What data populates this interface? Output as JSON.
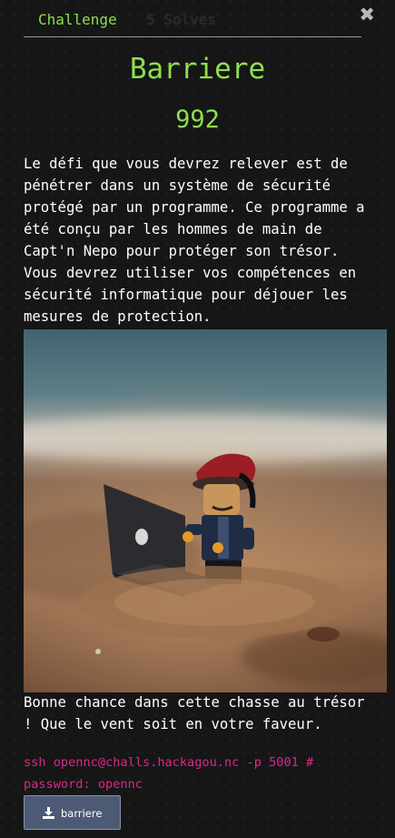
{
  "tabs": {
    "challenge_label": "Challenge",
    "solves_label": "5 Solves"
  },
  "close_icon": "close-icon",
  "challenge": {
    "name": "Barriere",
    "points": "992",
    "description": "Le défi que vous devrez relever est de\npénétrer dans un système de sécurité\nprotégé par un programme. Ce programme a\nété conçu par les hommes de main de\nCapt'n Nepo pour protéger son trésor.\nVous devrez utiliser vos compétences en\nsécurité informatique pour déjouer les\nmesures de protection.",
    "outro": "Bonne chance dans cette chasse au trésor\n! Que le vent soit en votre faveur.",
    "connection": "ssh opennc@challs.hackagou.nc -p 5001 #\npassword: opennc"
  },
  "download": {
    "icon": "download-icon",
    "label": "barriere"
  },
  "colors": {
    "accent_green": "#8ee04f",
    "ssh_pink": "#e0258e",
    "button_bg": "#4d5a76",
    "background": "#161616"
  }
}
